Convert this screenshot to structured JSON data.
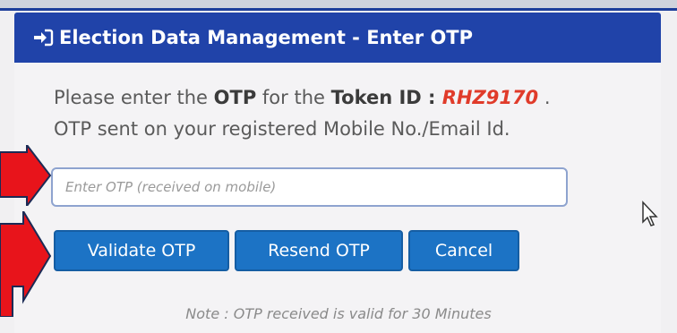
{
  "header": {
    "title": "Election Data Management - Enter OTP",
    "icon": "sign-in-icon"
  },
  "message": {
    "prefix": "Please enter the ",
    "otp_word": "OTP",
    "middle": " for the ",
    "token_label": "Token ID : ",
    "token_id": "RHZ9170",
    "suffix": " .",
    "line2": "OTP sent on your registered Mobile No./Email Id."
  },
  "otp_input": {
    "value": "",
    "placeholder": "Enter OTP (received on mobile)"
  },
  "buttons": {
    "validate": "Validate OTP",
    "resend": "Resend OTP",
    "cancel": "Cancel"
  },
  "note": "Note : OTP received is valid for 30 Minutes",
  "colors": {
    "header_bg": "#2043a9",
    "button_bg": "#1c73c5",
    "token_red": "#e03b2a",
    "annotation_red": "#e8141b"
  }
}
